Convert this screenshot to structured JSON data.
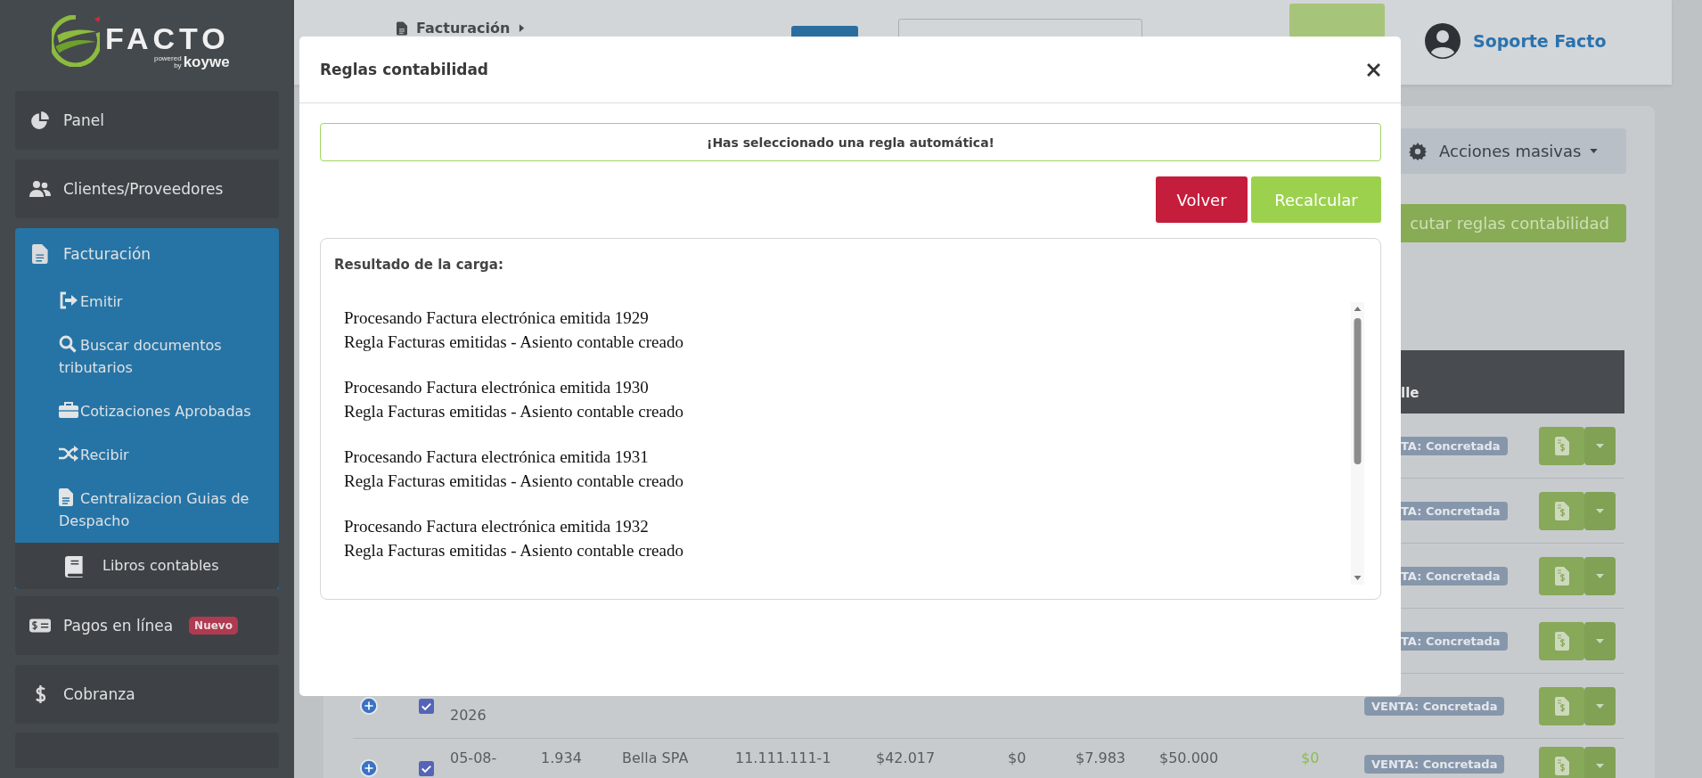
{
  "sidebar": {
    "logo": {
      "wordmark": "FACTO",
      "powered": "powered",
      "by": "by",
      "brand": "koywe"
    },
    "items": [
      {
        "label": "Panel",
        "expanded": false
      },
      {
        "label": "Clientes/Proveedores",
        "expanded": false
      },
      {
        "label": "Facturación",
        "expanded": true,
        "children": [
          {
            "label": "Emitir",
            "selected": false
          },
          {
            "label": "Buscar documentos tributarios",
            "selected": false
          },
          {
            "label": "Cotizaciones Aprobadas",
            "selected": false
          },
          {
            "label": "Recibir",
            "selected": false
          },
          {
            "label": "Centralizacion Guias de Despacho",
            "selected": false
          },
          {
            "label": "Libros contables",
            "selected": true
          }
        ]
      },
      {
        "label": "Pagos en línea",
        "expanded": false,
        "badge": "Nuevo"
      },
      {
        "label": "Cobranza",
        "expanded": false
      }
    ]
  },
  "topbar": {
    "breadcrumb": "Facturación",
    "user": "Soporte Facto"
  },
  "toolbar": {
    "bulk_actions": "Acciones masivas",
    "run_rules": "cutar reglas contabilidad"
  },
  "table": {
    "header": "lle",
    "rows": [
      {
        "kind": "covered",
        "badge": "TA: Concretada"
      },
      {
        "kind": "covered",
        "badge": "TA: Concretada"
      },
      {
        "kind": "covered",
        "badge": "TA: Concretada"
      },
      {
        "kind": "covered",
        "badge": "TA: Concretada"
      },
      {
        "kind": "lower",
        "checked": true,
        "date": "2026",
        "badge": "VENTA: Concretada"
      },
      {
        "kind": "full",
        "checked": true,
        "date": "05-08-",
        "cells": [
          "1.934",
          "Bella SPA",
          "11.111.111-1",
          "$42.017",
          "$0",
          "$7.983",
          "$50.000"
        ],
        "paid": "$0",
        "badge": "VENTA: Concretada"
      }
    ]
  },
  "modal": {
    "title": "Reglas contabilidad",
    "alert": "¡Has seleccionado una regla automática!",
    "buttons": [
      {
        "kind": "danger",
        "label": "Volver"
      },
      {
        "kind": "success",
        "label": "Recalcular"
      }
    ],
    "result_title": "Resultado de la carga:",
    "log": [
      {
        "lines": [
          "Procesando Factura electrónica emitida 1929",
          "Regla Facturas emitidas - Asiento contable creado"
        ]
      },
      {
        "lines": [
          "Procesando Factura electrónica emitida 1930",
          "Regla Facturas emitidas - Asiento contable creado"
        ]
      },
      {
        "lines": [
          "Procesando Factura electrónica emitida 1931",
          "Regla Facturas emitidas - Asiento contable creado"
        ]
      },
      {
        "lines": [
          "Procesando Factura electrónica emitida 1932",
          "Regla Facturas emitidas - Asiento contable creado"
        ]
      }
    ]
  }
}
